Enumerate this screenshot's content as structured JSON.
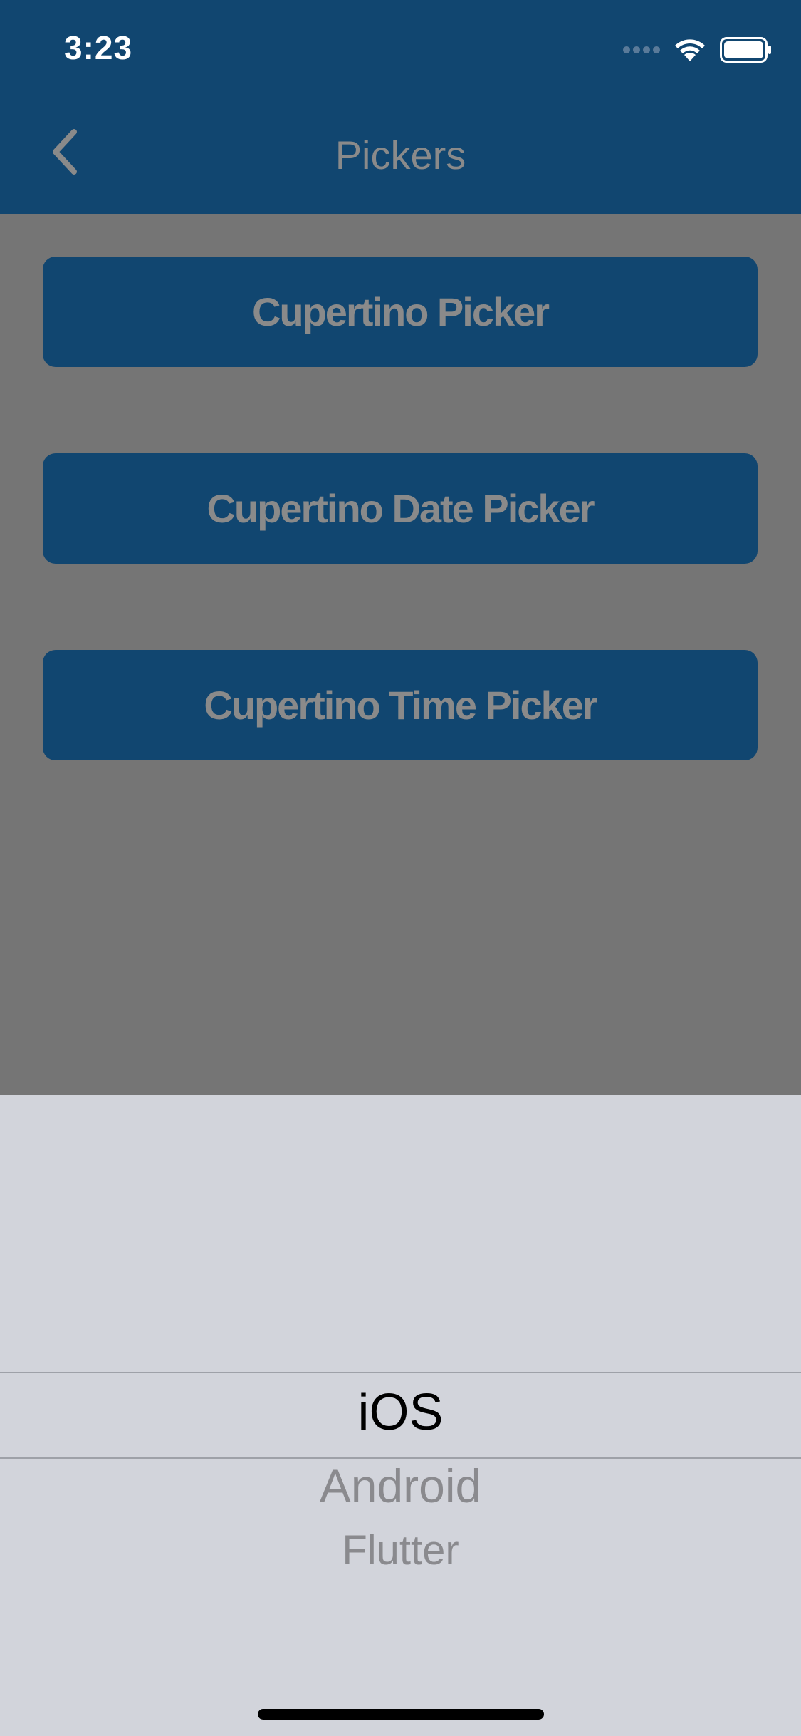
{
  "status_bar": {
    "time": "3:23",
    "icons": [
      "cellular-dots-icon",
      "wifi-icon",
      "battery-icon"
    ]
  },
  "app_bar": {
    "title": "Pickers",
    "back_icon": "chevron-left-icon"
  },
  "buttons": {
    "cupertino_picker": "Cupertino Picker",
    "cupertino_date_picker": "Cupertino Date Picker",
    "cupertino_time_picker": "Cupertino Time Picker"
  },
  "picker": {
    "selected": "iOS",
    "items": [
      "iOS",
      "Android",
      "Flutter"
    ]
  },
  "colors": {
    "app_bar": "#114670",
    "button": "#114670",
    "overlay": "#757575",
    "sheet": "#d2d4db",
    "muted_text": "#8a8a8a"
  }
}
